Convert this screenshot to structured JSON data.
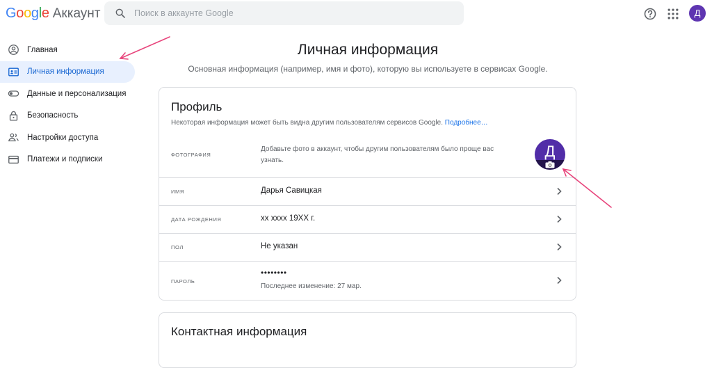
{
  "header": {
    "logo_google": "Google",
    "logo_account": "Аккаунт",
    "search_placeholder": "Поиск в аккаунте Google",
    "user_initial": "Д",
    "icons": [
      "help-icon",
      "apps-grid-icon"
    ]
  },
  "sidebar": {
    "items": [
      {
        "label": "Главная",
        "icon": "account-circle-icon",
        "active": false
      },
      {
        "label": "Личная информация",
        "icon": "id-card-icon",
        "active": true
      },
      {
        "label": "Данные и персонализация",
        "icon": "toggle-icon",
        "active": false
      },
      {
        "label": "Безопасность",
        "icon": "lock-icon",
        "active": false
      },
      {
        "label": "Настройки доступа",
        "icon": "people-icon",
        "active": false
      },
      {
        "label": "Платежи и подписки",
        "icon": "credit-card-icon",
        "active": false
      }
    ]
  },
  "main": {
    "title": "Личная информация",
    "subtitle": "Основная информация (например, имя и фото), которую вы используете в сервисах Google."
  },
  "profile_card": {
    "title": "Профиль",
    "description": "Некоторая информация может быть видна другим пользователям сервисов Google.",
    "more_link": "Подробнее…",
    "photo": {
      "label": "ФОТОГРАФИЯ",
      "text": "Добавьте фото в аккаунт, чтобы другим пользователям было проще вас узнать.",
      "avatar_initial": "Д"
    },
    "rows": [
      {
        "label": "ИМЯ",
        "value": "Дарья Савицкая"
      },
      {
        "label": "ДАТА РОЖДЕНИЯ",
        "value": "хх хххх 19ХХ г."
      },
      {
        "label": "ПОЛ",
        "value": "Не указан"
      },
      {
        "label": "ПАРОЛЬ",
        "value": "••••••••",
        "note": "Последнее изменение: 27 мар."
      }
    ]
  },
  "contact_card": {
    "title": "Контактная информация"
  },
  "colors": {
    "accent": "#1a73e8",
    "active_bg": "#e8f0fe",
    "avatar": "#512da8",
    "annotation_arrow": "#e8457c"
  }
}
